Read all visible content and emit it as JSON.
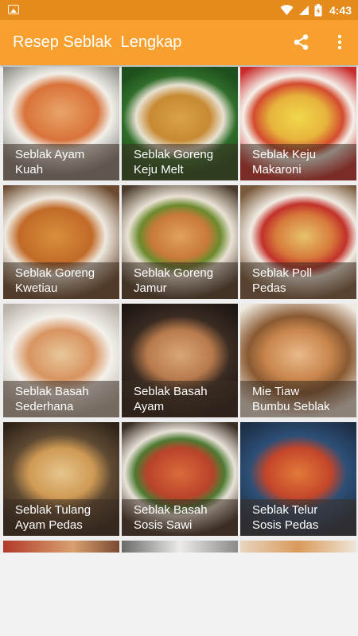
{
  "app": {
    "title": "Resep Seblak  Lengkap",
    "time": "4:43",
    "colors": {
      "status_bar": "#e58b1c",
      "app_bar": "#f7a02f"
    }
  },
  "recipes": [
    {
      "line1": "Seblak Ayam",
      "line2": "Kuah"
    },
    {
      "line1": "Seblak Goreng",
      "line2": "Keju Melt"
    },
    {
      "line1": "Seblak Keju",
      "line2": "Makaroni"
    },
    {
      "line1": "Seblak Goreng",
      "line2": "Kwetiau"
    },
    {
      "line1": "Seblak Goreng",
      "line2": "Jamur"
    },
    {
      "line1": "Seblak Poll",
      "line2": "Pedas"
    },
    {
      "line1": "Seblak Basah",
      "line2": "Sederhana"
    },
    {
      "line1": "Seblak Basah",
      "line2": "Ayam"
    },
    {
      "line1": "Mie Tiaw",
      "line2": "Bumbu Seblak"
    },
    {
      "line1": "Seblak Tulang",
      "line2": "Ayam Pedas"
    },
    {
      "line1": "Seblak Basah",
      "line2": "Sosis Sawi"
    },
    {
      "line1": "Seblak Telur",
      "line2": "Sosis Pedas"
    }
  ],
  "icons": [
    "notification-icon",
    "wifi-icon",
    "signal-icon",
    "battery-icon",
    "share-icon",
    "overflow-menu-icon"
  ]
}
